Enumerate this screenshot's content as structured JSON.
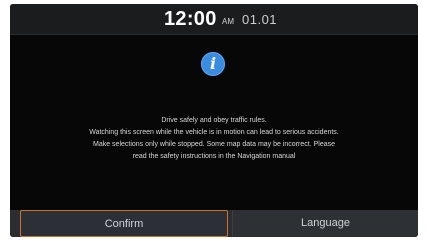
{
  "status_bar": {
    "time": "12:00",
    "ampm": "AM",
    "date": "01.01"
  },
  "dialog": {
    "icon": "info-icon",
    "lines": [
      "Drive safely and obey traffic rules.",
      "Watching this screen while the vehicle is in motion can lead to serious accidents.",
      "Make selections only while stopped. Some map data may be incorrect. Please",
      "read the safety instructions in the Navigation manual"
    ]
  },
  "buttons": {
    "confirm_label": "Confirm",
    "language_label": "Language"
  },
  "colors": {
    "accent_focus": "#c9722b",
    "info_blue": "#3a8ce0",
    "background": "#070707"
  }
}
